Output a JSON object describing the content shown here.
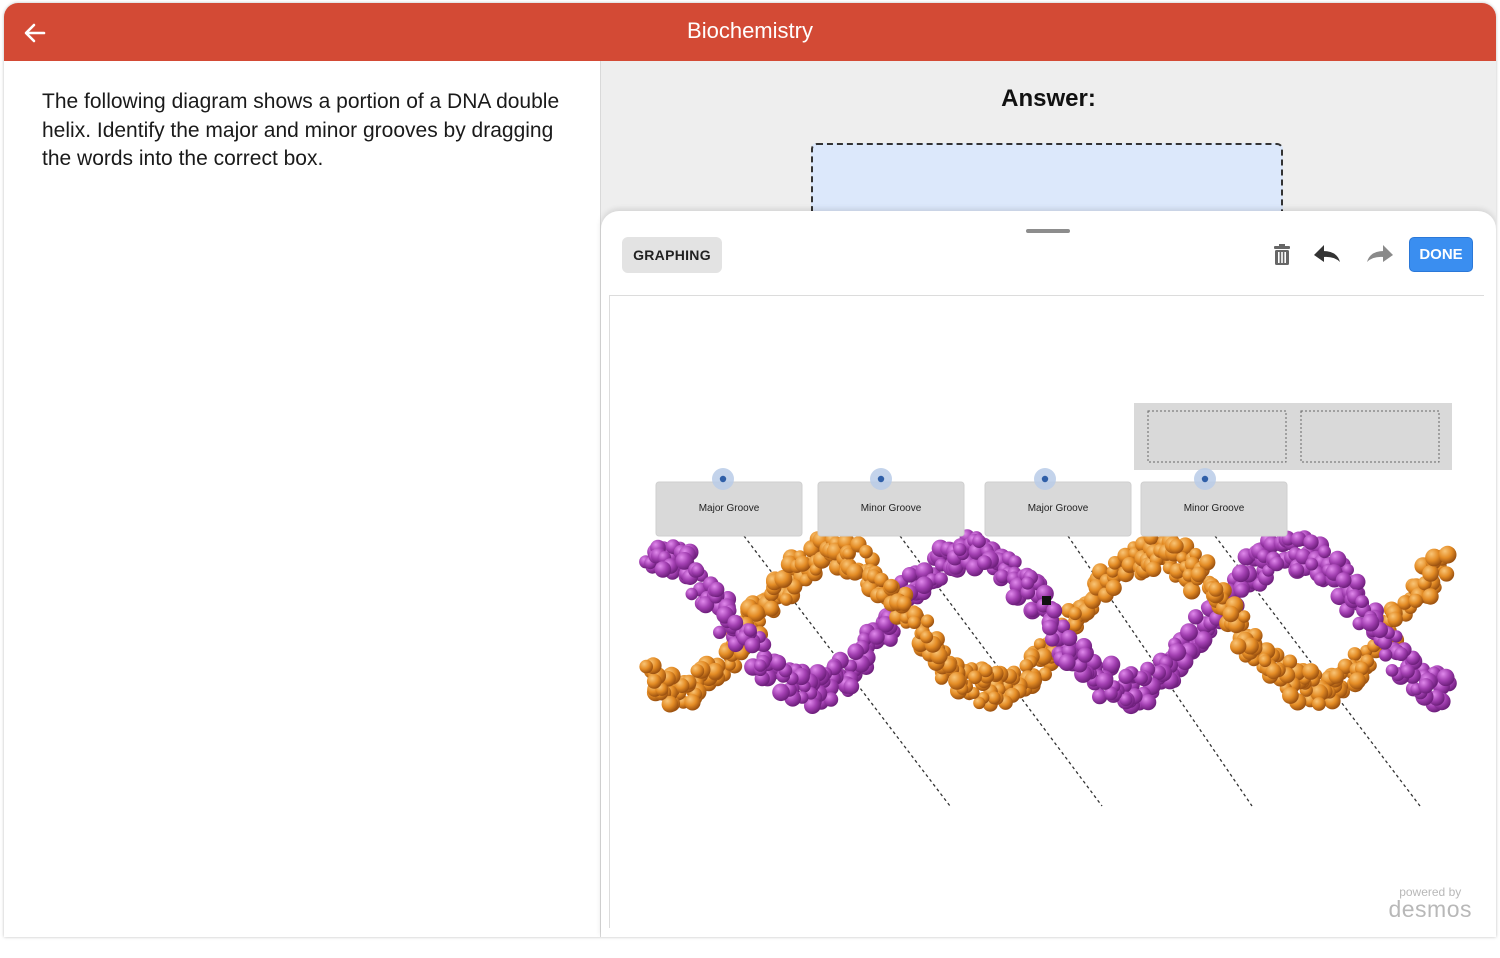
{
  "header": {
    "title": "Biochemistry"
  },
  "question": {
    "text": "The following diagram shows a portion of a DNA double helix. Identify the major and minor grooves by dragging the words into the correct box."
  },
  "answer": {
    "label": "Answer:"
  },
  "toolbar": {
    "graphing_label": "GRAPHING",
    "done_label": "DONE"
  },
  "labels": [
    "Major Groove",
    "Minor Groove",
    "Major Groove",
    "Minor Groove"
  ],
  "branding": {
    "powered_by": "powered by",
    "name": "desmos"
  },
  "colors": {
    "header": "#d34a35",
    "done": "#3a8ef0",
    "strand_purple": "#a340b2",
    "strand_orange": "#e48c25"
  }
}
